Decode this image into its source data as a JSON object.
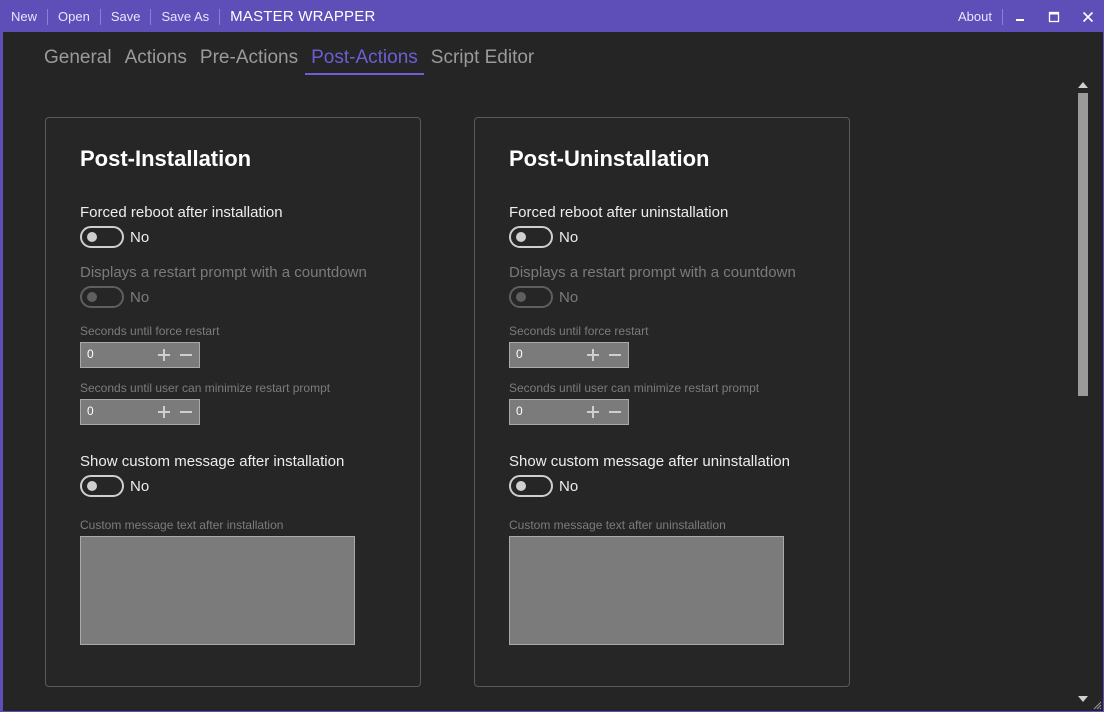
{
  "titlebar": {
    "menu": [
      "New",
      "Open",
      "Save",
      "Save As"
    ],
    "app_title": "MASTER WRAPPER",
    "about": "About"
  },
  "tabs": [
    {
      "label": "General"
    },
    {
      "label": "Actions"
    },
    {
      "label": "Pre-Actions"
    },
    {
      "label": "Post-Actions",
      "active": true
    },
    {
      "label": "Script Editor"
    }
  ],
  "post_installation": {
    "title": "Post-Installation",
    "forced_reboot_label": "Forced reboot after installation",
    "forced_reboot_value": "No",
    "restart_prompt_label": "Displays a restart prompt with a countdown",
    "restart_prompt_value": "No",
    "seconds_force_label": "Seconds until force restart",
    "seconds_force_value": "0",
    "seconds_minimize_label": "Seconds until user can minimize restart prompt",
    "seconds_minimize_value": "0",
    "custom_message_label": "Show custom message after installation",
    "custom_message_value": "No",
    "custom_text_label": "Custom message text after installation"
  },
  "post_uninstallation": {
    "title": "Post-Uninstallation",
    "forced_reboot_label": "Forced reboot after uninstallation",
    "forced_reboot_value": "No",
    "restart_prompt_label": "Displays a restart prompt with a countdown",
    "restart_prompt_value": "No",
    "seconds_force_label": "Seconds until force restart",
    "seconds_force_value": "0",
    "seconds_minimize_label": "Seconds until user can minimize restart prompt",
    "seconds_minimize_value": "0",
    "custom_message_label": "Show custom message after uninstallation",
    "custom_message_value": "No",
    "custom_text_label": "Custom message text after uninstallation"
  },
  "icons": {
    "minimize": "minimize-icon",
    "maximize": "maximize-icon",
    "close": "close-icon",
    "plus": "plus-icon",
    "minus": "minus-icon"
  },
  "colors": {
    "accent": "#5e4fb8",
    "active_tab": "#6c5ed4",
    "background": "#252526",
    "field": "#7b7b7b"
  }
}
